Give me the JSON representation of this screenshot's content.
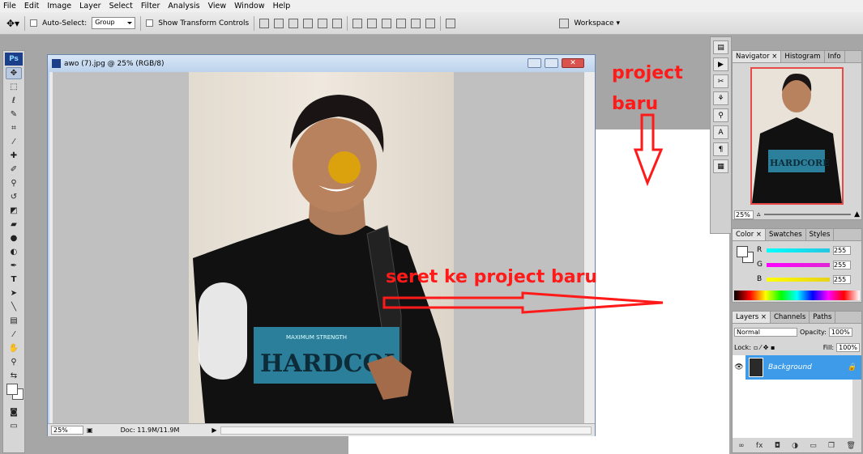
{
  "menu": [
    "File",
    "Edit",
    "Image",
    "Layer",
    "Select",
    "Filter",
    "Analysis",
    "View",
    "Window",
    "Help"
  ],
  "options": {
    "auto_select_label": "Auto-Select:",
    "auto_select_value": "Group",
    "show_transform_label": "Show Transform Controls",
    "workspace_label": "Workspace"
  },
  "toolbox": {
    "logo": "Ps"
  },
  "document": {
    "title": "awo (7).jpg @ 25% (RGB/8)",
    "zoom": "25%",
    "doc_info": "Doc: 11.9M/11.9M"
  },
  "annotations": {
    "project_line1": "project",
    "project_line2": "baru",
    "drag_instruction": "seret ke project baru"
  },
  "navigator": {
    "tabs": [
      "Navigator",
      "Histogram",
      "Info"
    ],
    "zoom": "25%",
    "tshirt_text": "HARDCORE"
  },
  "color_panel": {
    "tabs": [
      "Color",
      "Swatches",
      "Styles"
    ],
    "channels": [
      {
        "label": "R",
        "value": "255",
        "color": "#27c6e0"
      },
      {
        "label": "G",
        "value": "255",
        "color": "#e027d4"
      },
      {
        "label": "B",
        "value": "255",
        "color": "#e6d21a"
      }
    ]
  },
  "layers_panel": {
    "tabs": [
      "Layers",
      "Channels",
      "Paths"
    ],
    "blend_mode": "Normal",
    "opacity_label": "Opacity:",
    "opacity_value": "100%",
    "lock_label": "Lock:",
    "fill_label": "Fill:",
    "fill_value": "100%",
    "layer_name": "Background"
  },
  "shirt": {
    "brand": "HARDCOI",
    "tagline": "MAXIMUM STRENGTH"
  },
  "colors": {
    "annotation_red": "#ff1a1a",
    "layer_selected": "#3d9be9"
  }
}
